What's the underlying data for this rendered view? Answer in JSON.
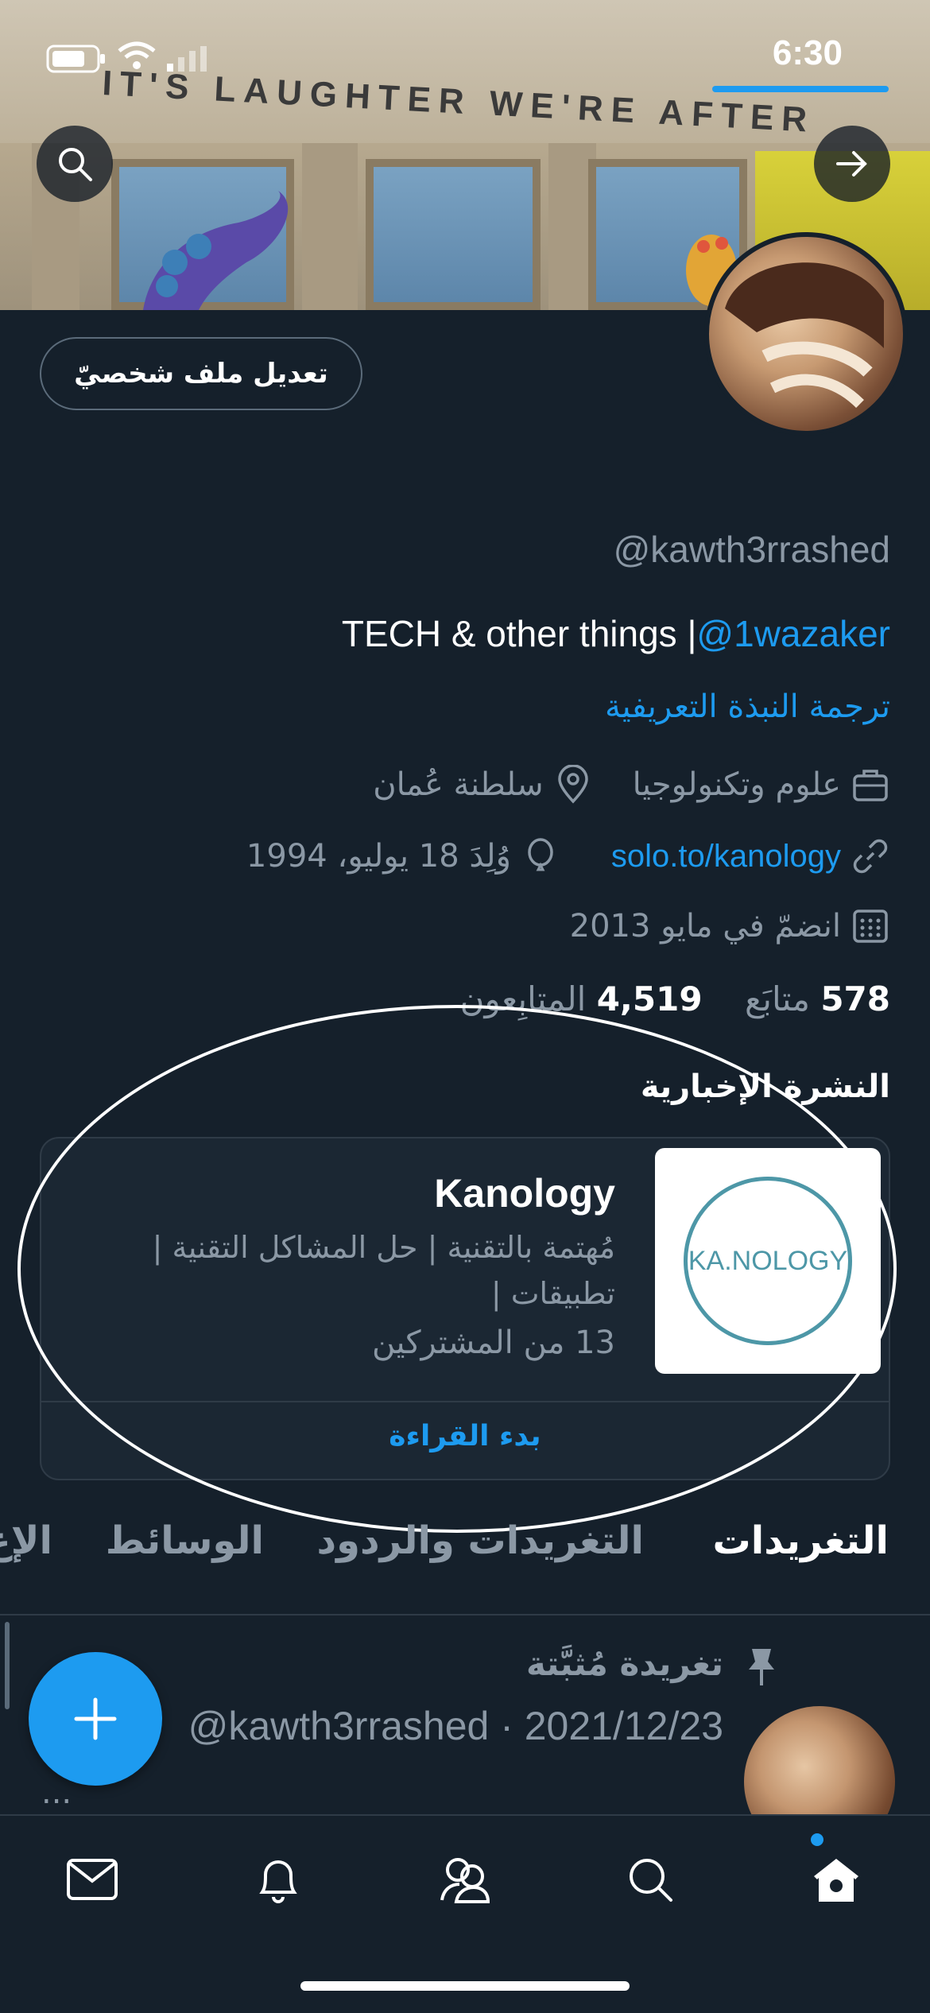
{
  "status_bar": {
    "time": "6:30"
  },
  "banner": {
    "sign_text": "IT'S LAUGHTER WE'RE AFTER"
  },
  "profile": {
    "edit_button": "تعديل ملف شخصيّ",
    "handle": "@kawth3rrashed",
    "bio_text": "TECH & other things |",
    "bio_mention": "@1wazaker",
    "translate_bio": "ترجمة النبذة التعريفية",
    "category": "علوم وتكنولوجيا",
    "location": "سلطنة عُمان",
    "website": "solo.to/kanology",
    "birthday": "وُلِدَ 18 يوليو، 1994",
    "joined": "انضمّ في مايو 2013",
    "following_count": "578",
    "following_label": "متابَع",
    "followers_count": "4,519",
    "followers_label": "المتابِعون"
  },
  "newsletter": {
    "section_title": "النشرة الإخبارية",
    "name": "Kanology",
    "description": "مُهتمة بالتقنية | حل المشاكل التقنية | تطبيقات |",
    "subscribers": "13 من المشتركين",
    "logo_text": "KA.NOLOGY",
    "read_button": "بدء القراءة"
  },
  "tabs": [
    {
      "label": "التغريدات",
      "active": true
    },
    {
      "label": "التغريدات والردود",
      "active": false
    },
    {
      "label": "الوسائط",
      "active": false
    },
    {
      "label": "الإع",
      "active": false
    }
  ],
  "pinned_tweet": {
    "label": "تغريدة مُثبَّتة",
    "meta": "@kawth3rrashed · 2021/12/23",
    "more": "..."
  },
  "colors": {
    "background": "#15202b",
    "accent": "#1d9bf0",
    "muted": "#8b98a5",
    "border": "#2f3b47"
  }
}
